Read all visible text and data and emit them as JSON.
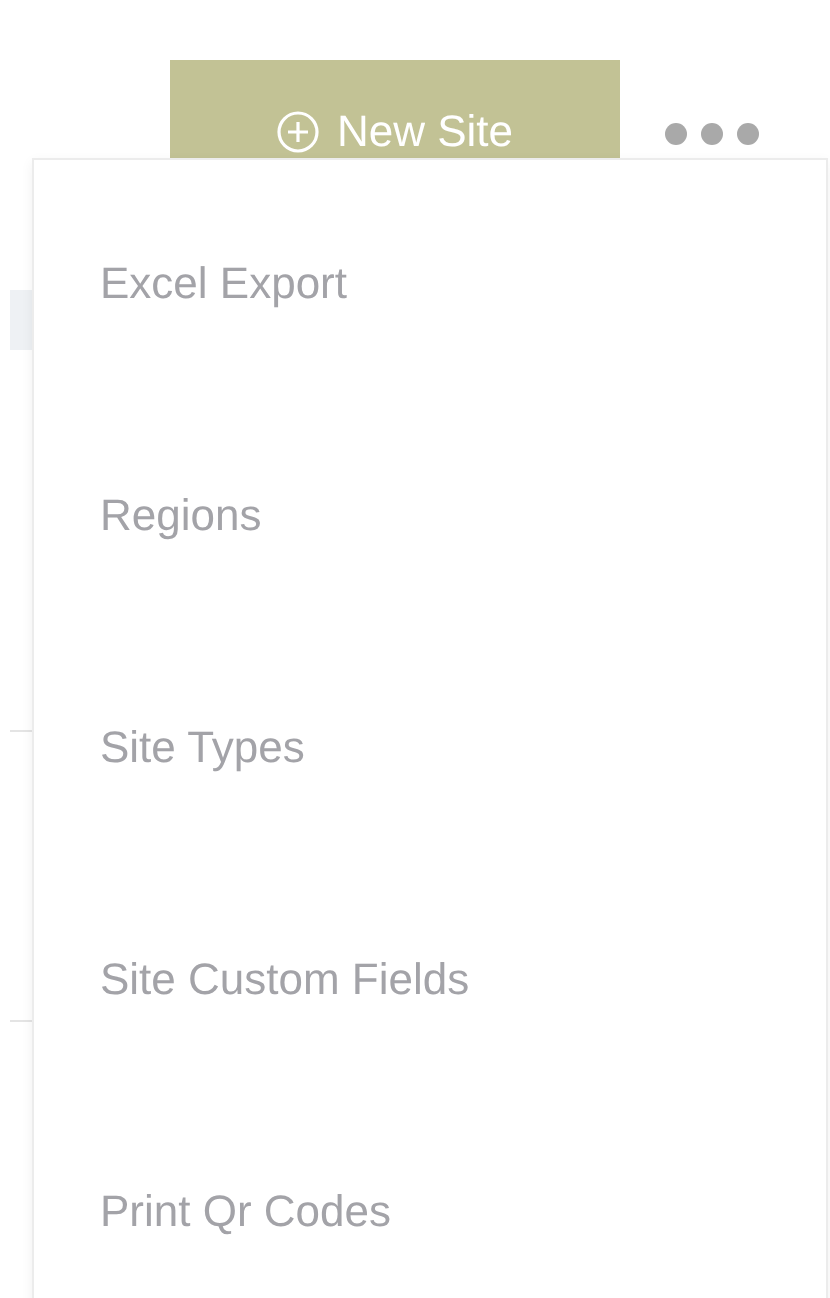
{
  "toolbar": {
    "new_button": {
      "label": "New Site"
    }
  },
  "menu": {
    "items": [
      {
        "label": "Excel Export"
      },
      {
        "label": "Regions"
      },
      {
        "label": "Site Types"
      },
      {
        "label": "Site Custom Fields"
      },
      {
        "label": "Print Qr Codes"
      }
    ]
  }
}
